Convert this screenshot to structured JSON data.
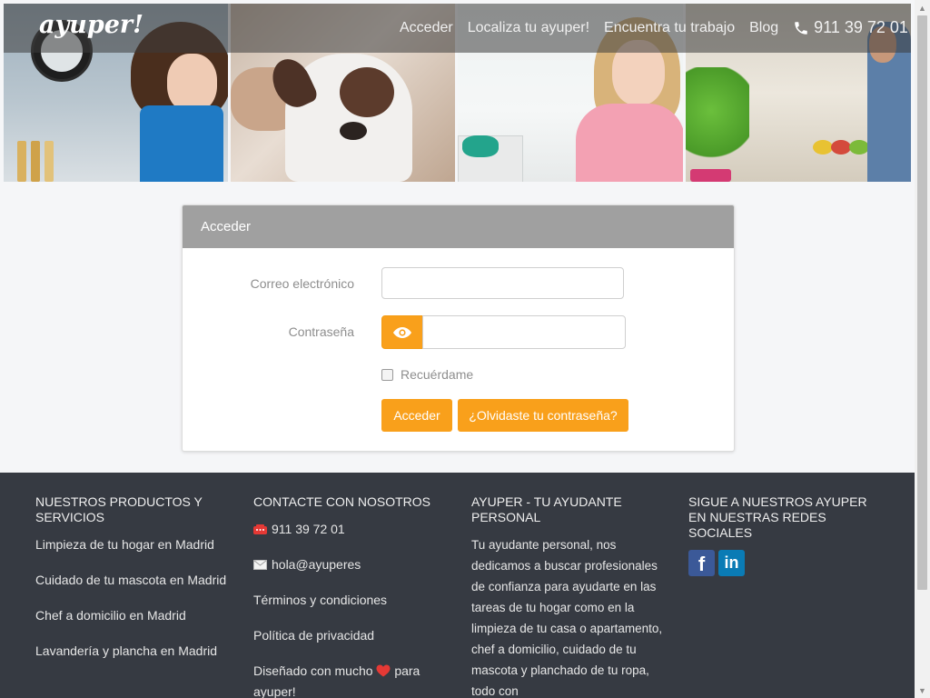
{
  "nav": {
    "logo": "ayuper!",
    "links": [
      "Acceder",
      "Localiza tu ayuper!",
      "Encuentra tu trabajo",
      "Blog"
    ],
    "phone": "911 39 72 01"
  },
  "login": {
    "title": "Acceder",
    "email_label": "Correo electrónico",
    "email_value": "",
    "password_label": "Contraseña",
    "password_value": "",
    "remember_label": "Recuérdame",
    "login_button": "Acceder",
    "forgot_button": "¿Olvidaste tu contraseña?"
  },
  "footer": {
    "products": {
      "title": "NUESTROS PRODUCTOS Y SERVICIOS",
      "items": [
        "Limpieza de tu hogar en Madrid",
        "Cuidado de tu mascota en Madrid",
        "Chef a domicilio en Madrid",
        "Lavandería y plancha en Madrid"
      ]
    },
    "contact": {
      "title": "CONTACTE CON NOSOTROS",
      "phone": "911 39 72 01",
      "email": "hola@ayuperes",
      "terms": "Términos y condiciones",
      "privacy": "Política de privacidad",
      "designed_pre": "Diseñado con mucho",
      "designed_post": "para ayuper!"
    },
    "about": {
      "title": "AYUPER - TU AYUDANTE PERSONAL",
      "text": "Tu ayudante personal, nos dedicamos a buscar profesionales de confianza para ayudarte en las tareas de tu hogar como en la limpieza de tu casa o apartamento, chef a domicilio, cuidado de tu mascota y planchado de tu ropa, todo con"
    },
    "social": {
      "title": "SIGUE A NUESTROS AYUPER EN NUESTRAS REDES SOCIALES",
      "facebook": "f",
      "linkedin": "in"
    }
  },
  "colors": {
    "accent": "#f9a01b",
    "footer_bg": "#363a42",
    "card_header": "#a0a0a0",
    "heart": "#e53935"
  }
}
